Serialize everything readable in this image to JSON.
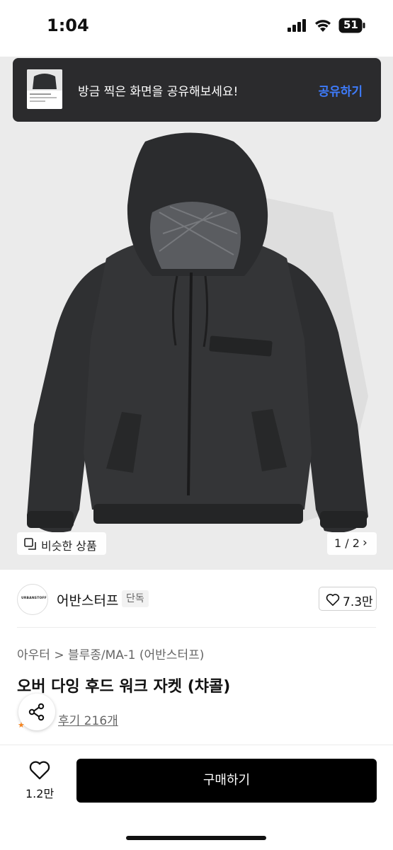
{
  "status_bar": {
    "time": "1:04",
    "battery": "51"
  },
  "toast": {
    "message": "방금 찍은 화면을 공유해보세요!",
    "action": "공유하기"
  },
  "gallery": {
    "similar_label": "비슷한 상품",
    "pager": "1 / 2"
  },
  "brand": {
    "logo_text": "URBANSTOFF",
    "name": "어반스터프",
    "badge": "단독",
    "like_count": "7.3만"
  },
  "product": {
    "breadcrumb": "아우터 > 블루종/MA-1 (어반스터프)",
    "title": "오버 다잉 후드 워크 자켓 (챠콜)",
    "reviews": "후기 216개"
  },
  "bottom_bar": {
    "wish_count": "1.2만",
    "buy_label": "구매하기"
  },
  "colors": {
    "accent": "#3e7bfa",
    "toast_bg": "#2b2b2d",
    "buy_bg": "#000000",
    "star": "#f5841f"
  },
  "icons": [
    "signal-icon",
    "wifi-icon",
    "battery-icon",
    "similar-products-icon",
    "chevron-right-icon",
    "heart-icon",
    "share-icon"
  ]
}
